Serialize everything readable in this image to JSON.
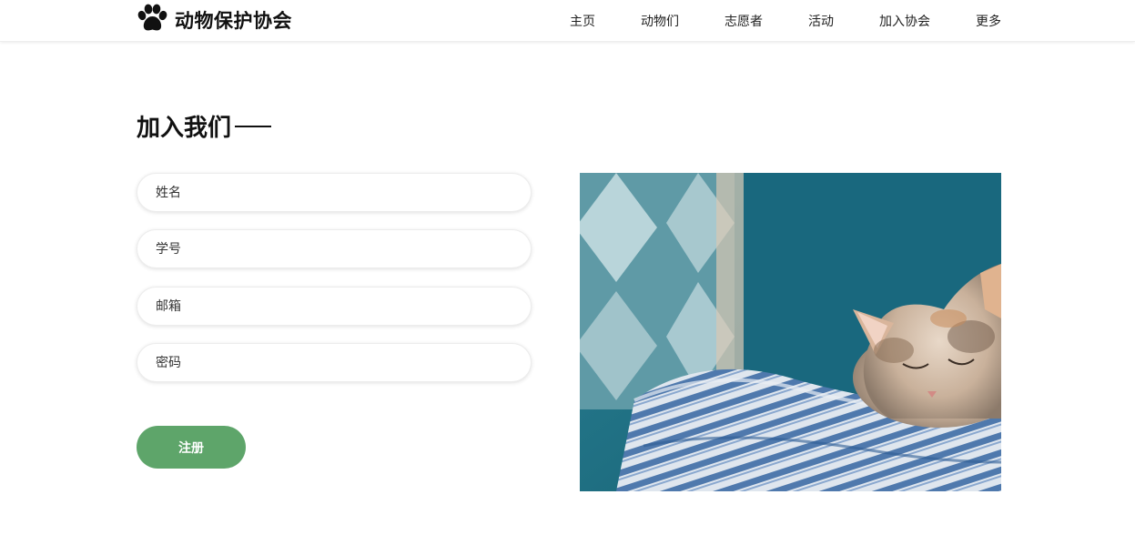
{
  "header": {
    "brand_title": "动物保护协会",
    "logo_icon": "paw-icon",
    "nav": [
      "主页",
      "动物们",
      "志愿者",
      "活动",
      "加入协会",
      "更多"
    ]
  },
  "form": {
    "title": "加入我们",
    "fields": {
      "name_placeholder": "姓名",
      "student_id_placeholder": "学号",
      "email_placeholder": "邮箱",
      "password_placeholder": "密码"
    },
    "submit_label": "注册"
  },
  "image": {
    "subject": "sleeping-cat-on-blanket"
  },
  "colors": {
    "accent_green": "#5ea56a",
    "text_dark": "#111111",
    "photo_teal": "#1f6f82"
  }
}
